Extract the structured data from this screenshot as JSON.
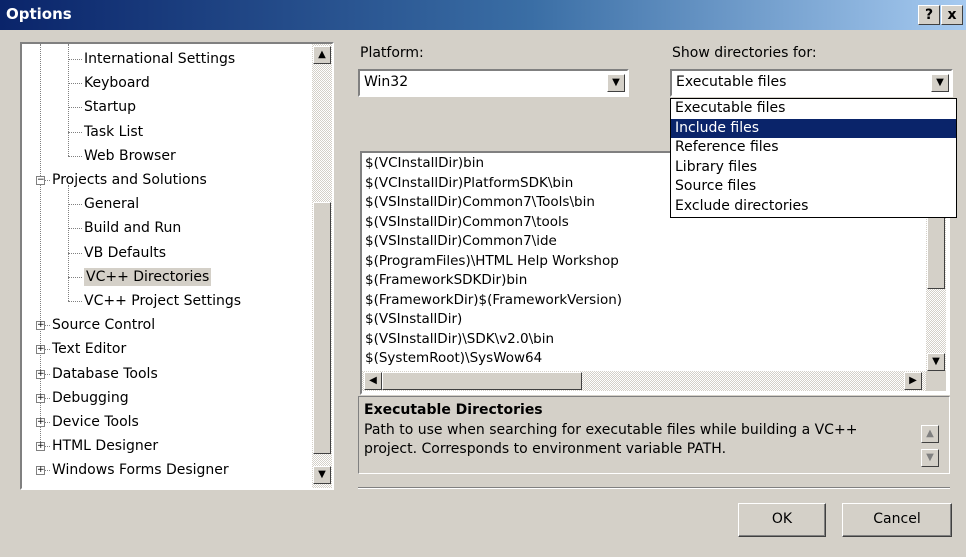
{
  "window": {
    "title": "Options",
    "help_label": "?",
    "close_label": "x"
  },
  "tree": {
    "items": [
      {
        "label": "International Settings",
        "level": 1
      },
      {
        "label": "Keyboard",
        "level": 1
      },
      {
        "label": "Startup",
        "level": 1
      },
      {
        "label": "Task List",
        "level": 1
      },
      {
        "label": "Web Browser",
        "level": 1
      },
      {
        "label": "Projects and Solutions",
        "level": 0,
        "expander": "−"
      },
      {
        "label": "General",
        "level": 1
      },
      {
        "label": "Build and Run",
        "level": 1
      },
      {
        "label": "VB Defaults",
        "level": 1
      },
      {
        "label": "VC++ Directories",
        "level": 1,
        "selected": true
      },
      {
        "label": "VC++ Project Settings",
        "level": 1
      },
      {
        "label": "Source Control",
        "level": 0,
        "expander": "+"
      },
      {
        "label": "Text Editor",
        "level": 0,
        "expander": "+"
      },
      {
        "label": "Database Tools",
        "level": 0,
        "expander": "+"
      },
      {
        "label": "Debugging",
        "level": 0,
        "expander": "+"
      },
      {
        "label": "Device Tools",
        "level": 0,
        "expander": "+"
      },
      {
        "label": "HTML Designer",
        "level": 0,
        "expander": "+"
      },
      {
        "label": "Windows Forms Designer",
        "level": 0,
        "expander": "+"
      }
    ]
  },
  "platform": {
    "label": "Platform:",
    "value": "Win32"
  },
  "show_dirs": {
    "label": "Show directories for:",
    "value": "Executable files",
    "options": [
      "Executable files",
      "Include files",
      "Reference files",
      "Library files",
      "Source files",
      "Exclude directories"
    ],
    "highlighted_index": 1
  },
  "directories": [
    "$(VCInstallDir)bin",
    "$(VCInstallDir)PlatformSDK\\bin",
    "$(VSInstallDir)Common7\\Tools\\bin",
    "$(VSInstallDir)Common7\\tools",
    "$(VSInstallDir)Common7\\ide",
    "$(ProgramFiles)\\HTML Help Workshop",
    "$(FrameworkSDKDir)bin",
    "$(FrameworkDir)$(FrameworkVersion)",
    "$(VSInstallDir)",
    "$(VSInstallDir)\\SDK\\v2.0\\bin",
    "$(SystemRoot)\\SysWow64"
  ],
  "description": {
    "title": "Executable Directories",
    "text": "Path to use when searching for executable files while building a VC++ project.  Corresponds to environment variable PATH."
  },
  "buttons": {
    "ok": "OK",
    "cancel": "Cancel"
  }
}
